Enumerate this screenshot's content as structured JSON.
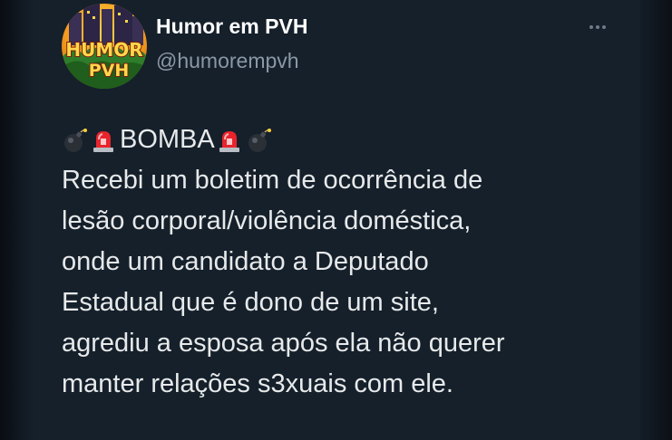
{
  "tweet": {
    "display_name": "Humor em PVH",
    "handle": "@humorempvh",
    "avatar_text_top": "HUMOR",
    "avatar_text_bottom": "PVH",
    "more_icon": "more-horizontal-icon",
    "headline_emoji": [
      "bomb-icon",
      "police-light-icon",
      "police-light-icon",
      "bomb-icon"
    ],
    "headline": "BOMBA",
    "lines": [
      "Recebi um boletim de ocorrência de",
      "lesão corporal/violência doméstica,",
      "onde um candidato a Deputado",
      "Estadual que é dono de um site,",
      "agrediu a esposa após ela não querer",
      "manter relações s3xuais com ele."
    ]
  },
  "colors": {
    "background": "#15202b",
    "text": "#e7e9ea",
    "secondary_text": "#8b98a5"
  }
}
